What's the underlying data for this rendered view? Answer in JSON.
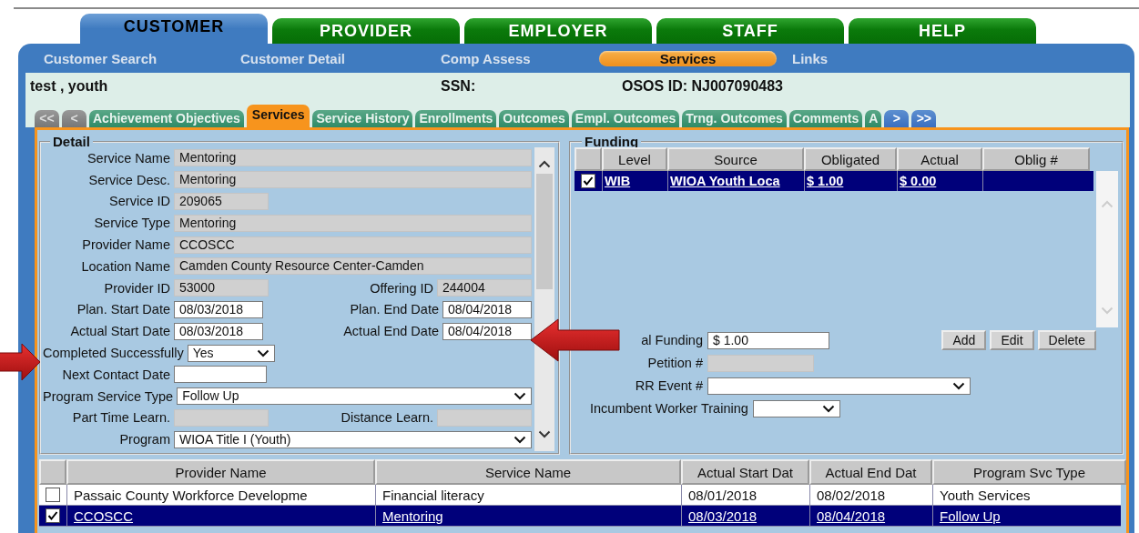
{
  "top_tabs": [
    {
      "label": "CUSTOMER",
      "selected": true
    },
    {
      "label": "PROVIDER",
      "selected": false
    },
    {
      "label": "EMPLOYER",
      "selected": false
    },
    {
      "label": "STAFF",
      "selected": false
    },
    {
      "label": "HELP",
      "selected": false
    }
  ],
  "sub_nav": [
    {
      "label": "Customer Search",
      "selected": false
    },
    {
      "label": "Customer Detail",
      "selected": false
    },
    {
      "label": "Comp Assess",
      "selected": false
    },
    {
      "label": "Services",
      "selected": true
    },
    {
      "label": "Links",
      "selected": false
    }
  ],
  "customer": {
    "name": "test , youth",
    "ssn_label": "SSN:",
    "osos_id": "OSOS ID: NJ007090483"
  },
  "page_tabs": {
    "back_buttons": [
      "<<",
      "<"
    ],
    "tabs": [
      {
        "label": "Achievement Objectives",
        "selected": false
      },
      {
        "label": "Services",
        "selected": true
      },
      {
        "label": "Service History",
        "selected": false
      },
      {
        "label": "Enrollments",
        "selected": false
      },
      {
        "label": "Outcomes",
        "selected": false
      },
      {
        "label": "Empl. Outcomes",
        "selected": false
      },
      {
        "label": "Trng. Outcomes",
        "selected": false
      },
      {
        "label": "Comments",
        "selected": false
      },
      {
        "label": "A",
        "selected": false
      }
    ],
    "forward_buttons": [
      ">",
      ">>"
    ]
  },
  "detail": {
    "title": "Detail",
    "rows": [
      [
        {
          "label": "Service Name",
          "kind": "readonly_wide",
          "value": "Mentoring"
        }
      ],
      [
        {
          "label": "Service Desc.",
          "kind": "readonly_wide",
          "value": "Mentoring"
        }
      ],
      [
        {
          "label": "Service ID",
          "kind": "readonly_short",
          "value": "209065"
        }
      ],
      [
        {
          "label": "Service Type",
          "kind": "readonly_wide",
          "value": "Mentoring"
        }
      ],
      [
        {
          "label": "Provider Name",
          "kind": "readonly_wide",
          "value": "CCOSCC"
        }
      ],
      [
        {
          "label": "Location Name",
          "kind": "readonly_wide",
          "value": "Camden County Resource Center-Camden"
        }
      ],
      [
        {
          "label": "Provider ID",
          "kind": "readonly_short",
          "value": "53000"
        },
        {
          "label": "Offering ID",
          "kind": "readonly_short",
          "value": "244004"
        }
      ],
      [
        {
          "label": "Plan. Start Date",
          "kind": "date",
          "value": "08/03/2018"
        },
        {
          "label": "Plan. End Date",
          "kind": "date",
          "value": "08/04/2018"
        }
      ],
      [
        {
          "label": "Actual Start Date",
          "kind": "date",
          "value": "08/03/2018"
        },
        {
          "label": "Actual End Date",
          "kind": "date",
          "value": "08/04/2018"
        }
      ],
      [
        {
          "label": "Completed Successfully",
          "kind": "select_short",
          "value": "Yes"
        }
      ],
      [
        {
          "label": "Next Contact Date",
          "kind": "input_short"
        }
      ],
      [
        {
          "label": "Program Service Type",
          "kind": "select_wide",
          "value": "Follow Up"
        }
      ],
      [
        {
          "label": "Part Time Learn.",
          "kind": "readonly_short"
        },
        {
          "label": "Distance Learn.",
          "kind": "readonly_short"
        }
      ],
      [
        {
          "label": "Program",
          "kind": "select_wide",
          "value": "WIOA Title I (Youth)"
        }
      ]
    ]
  },
  "funding": {
    "title": "Funding",
    "columns": [
      "Level",
      "Source",
      "Obligated",
      "Actual",
      "Oblig #"
    ],
    "rows": [
      {
        "checked": true,
        "selected": true,
        "cells": [
          "WIB",
          "WIOA Youth Loca",
          "$ 1.00",
          "$ 0.00"
        ]
      }
    ],
    "fields": [
      {
        "label": "al Funding",
        "kind": "input",
        "value": "$ 1.00"
      },
      {
        "label": "Petition #",
        "kind": "readonly"
      },
      {
        "label": "RR Event #",
        "kind": "select_wide"
      },
      {
        "label": "Incumbent Worker Training",
        "kind": "select_short"
      }
    ],
    "buttons": [
      "Add",
      "Edit",
      "Delete"
    ]
  },
  "services_table": {
    "columns": [
      "Provider Name",
      "Service Name",
      "Actual Start Dat",
      "Actual End Dat",
      "Program Svc Type"
    ],
    "rows": [
      {
        "checked": false,
        "selected": false,
        "cells": [
          "Passaic County Workforce Developme",
          "Financial literacy",
          "08/01/2018",
          "08/02/2018",
          "Youth Services"
        ]
      },
      {
        "checked": true,
        "selected": true,
        "cells": [
          "CCOSCC",
          "Mentoring",
          "08/03/2018",
          "08/04/2018",
          "Follow Up"
        ]
      }
    ]
  },
  "callout_arrows": [
    {
      "kind": "right"
    },
    {
      "kind": "left"
    }
  ]
}
